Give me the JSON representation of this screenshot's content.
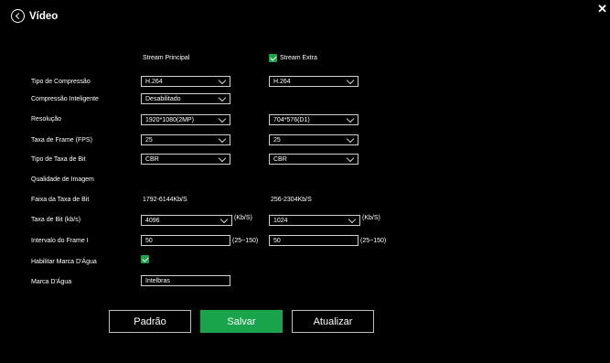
{
  "header": {
    "title": "Vídeo"
  },
  "columns": {
    "main": "Stream Principal",
    "extra": "Stream Extra",
    "extra_checked": true
  },
  "labels": {
    "compression": "Tipo de Compressão",
    "smart_compression": "Compressão Inteligente",
    "resolution": "Resolução",
    "frame_rate": "Taxa de Frame (FPS)",
    "bitrate_type": "Tipo de Taxa de Bit",
    "image_quality": "Qualidade de Imagem",
    "bitrate_range": "Faixa da Taxa de Bit",
    "bitrate": "Taxa de Bit (kb/s)",
    "iframe_interval": "Intervalo do Frame I",
    "enable_watermark": "Habilitar Marca D'Água",
    "watermark": "Marca D'Água"
  },
  "main": {
    "compression": "H.264",
    "smart_compression": "Desabilitado",
    "resolution": "1920*1080(2MP)",
    "frame_rate": "25",
    "bitrate_type": "CBR",
    "bitrate_range": "1792-6144Kb/S",
    "bitrate": "4096",
    "bitrate_unit": "(Kb/S)",
    "iframe_interval": "50",
    "iframe_range": "(25~150)"
  },
  "extra": {
    "compression": "H.264",
    "resolution": "704*576(D1)",
    "frame_rate": "25",
    "bitrate_type": "CBR",
    "bitrate_range": "256-2304Kb/S",
    "bitrate": "1024",
    "bitrate_unit": "(Kb/S)",
    "iframe_interval": "50",
    "iframe_range": "(25~150)"
  },
  "watermark": {
    "enabled": true,
    "text": "Intelbras"
  },
  "buttons": {
    "default": "Padrão",
    "save": "Salvar",
    "refresh": "Atualizar"
  },
  "colors": {
    "accent": "#19a34a",
    "background": "#000000"
  }
}
